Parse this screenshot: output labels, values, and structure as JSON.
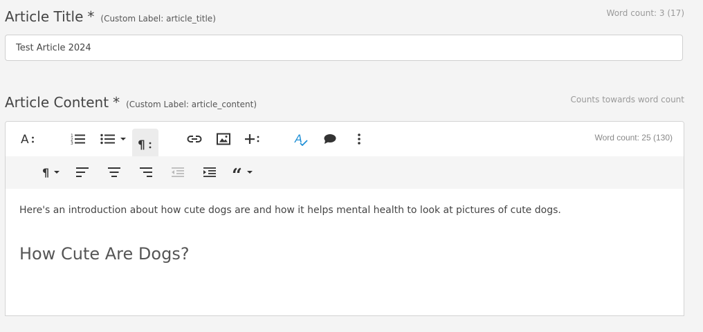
{
  "title_field": {
    "label": "Article Title",
    "required_marker": "*",
    "custom_label": "(Custom Label: article_title)",
    "word_count": "Word count: 3 (17)",
    "value": "Test Article 2024"
  },
  "content_field": {
    "label": "Article Content",
    "required_marker": "*",
    "custom_label": "(Custom Label: article_content)",
    "note": "Counts towards word count",
    "word_count": "Word count: 25 (130)",
    "paragraph": "Here's an introduction about how cute dogs are and how it helps mental health to look at pictures of cute dogs.",
    "heading": "How Cute Are Dogs?"
  },
  "toolbar": {
    "main": [
      "text-size-icon",
      "ordered-list-icon",
      "unordered-list-icon",
      "paragraph-format-icon",
      "link-icon",
      "image-icon",
      "insert-more-icon",
      "spellcheck-icon",
      "comment-icon",
      "more-vertical-icon"
    ],
    "sub": [
      "paragraph-style-icon",
      "align-left-icon",
      "align-center-icon",
      "align-right-icon",
      "outdent-icon",
      "indent-icon",
      "quote-icon"
    ]
  },
  "colors": {
    "background": "#f4f4f4",
    "spellcheck_accent": "#1e8fd6",
    "disabled_icon": "#bbbbbb"
  }
}
